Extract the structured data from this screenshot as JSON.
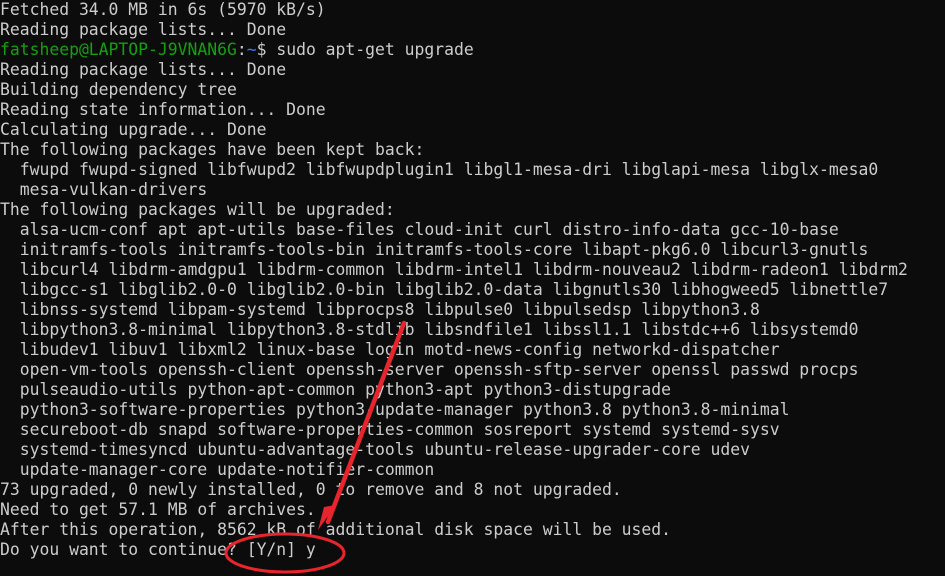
{
  "terminal": {
    "lines_before_prompt": [
      "Fetched 34.0 MB in 6s (5970 kB/s)",
      "Reading package lists... Done"
    ],
    "prompt": {
      "user_host": "fatsheep@LAPTOP-J9VNAN6G",
      "separator": ":",
      "path": "~",
      "symbol": "$",
      "command": " sudo apt-get upgrade"
    },
    "lines_after_prompt": [
      "Reading package lists... Done",
      "Building dependency tree",
      "Reading state information... Done",
      "Calculating upgrade... Done",
      "The following packages have been kept back:",
      "  fwupd fwupd-signed libfwupd2 libfwupdplugin1 libgl1-mesa-dri libglapi-mesa libglx-mesa0",
      "  mesa-vulkan-drivers",
      "The following packages will be upgraded:",
      "  alsa-ucm-conf apt apt-utils base-files cloud-init curl distro-info-data gcc-10-base",
      "  initramfs-tools initramfs-tools-bin initramfs-tools-core libapt-pkg6.0 libcurl3-gnutls",
      "  libcurl4 libdrm-amdgpu1 libdrm-common libdrm-intel1 libdrm-nouveau2 libdrm-radeon1 libdrm2",
      "  libgcc-s1 libglib2.0-0 libglib2.0-bin libglib2.0-data libgnutls30 libhogweed5 libnettle7",
      "  libnss-systemd libpam-systemd libprocps8 libpulse0 libpulsedsp libpython3.8",
      "  libpython3.8-minimal libpython3.8-stdlib libsndfile1 libssl1.1 libstdc++6 libsystemd0",
      "  libudev1 libuv1 libxml2 linux-base login motd-news-config networkd-dispatcher",
      "  open-vm-tools openssh-client openssh-server openssh-sftp-server openssl passwd procps",
      "  pulseaudio-utils python-apt-common python3-apt python3-distupgrade",
      "  python3-software-properties python3-update-manager python3.8 python3.8-minimal",
      "  secureboot-db snapd software-properties-common sosreport systemd systemd-sysv",
      "  systemd-timesyncd ubuntu-advantage-tools ubuntu-release-upgrader-core udev",
      "  update-manager-core update-notifier-common",
      "73 upgraded, 0 newly installed, 0 to remove and 8 not upgraded.",
      "Need to get 57.1 MB of archives.",
      "After this operation, 8562 kB of additional disk space will be used."
    ],
    "continue_prompt": "Do you want to continue? [Y/n] ",
    "continue_input": "y"
  },
  "annotation": {
    "color": "#e8242d",
    "shapes": [
      "arrow",
      "ellipse"
    ]
  }
}
